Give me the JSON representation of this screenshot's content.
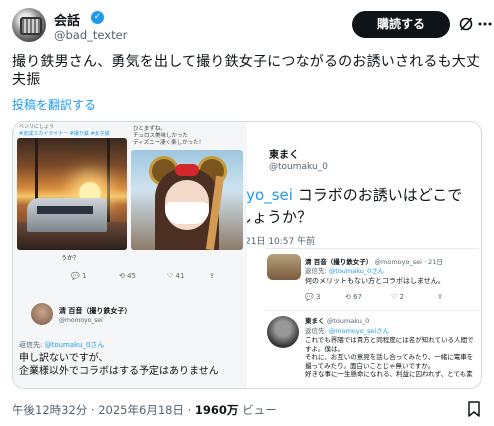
{
  "header": {
    "display_name": "会話",
    "handle": "@bad_texter",
    "subscribe_label": "購読する"
  },
  "tweet": {
    "text": "撮り鉄男さん、勇気を出して撮り鉄女子につながるのお誘いされるも大丈夫振",
    "translate_label": "投稿を翻訳する"
  },
  "left_shot": {
    "top_strip": "ベンリにしょう",
    "tags": "#京成スカイライナー #撮り鉄 #女子鉄",
    "note": "ひとまずね。\nチュロス美味しかった\nディズニー凄く楽しかった！",
    "uka": "うか？",
    "actions": {
      "reply": "1",
      "retweet": "45",
      "like": "41"
    },
    "reply_name": "清 百音（撮り鉄女子）",
    "reply_handle": "@momoyo_sei",
    "reply_to_prefix": "返信先: ",
    "reply_to_handle": "@toumaku_0さん",
    "reply_line1": "申し訳ないですが、",
    "reply_line2": "企業様以外でコラボはする予定はありません"
  },
  "right_shot": {
    "author": "東まく",
    "handle": "@toumaku_0",
    "text_mention": "oyo_sei",
    "text_rest": " コラボのお誘いはどこで",
    "text_line2": "しょうか？",
    "time": "21日 10:57 午前",
    "reply1": {
      "name": "清 百音（撮り鉄女子）",
      "meta": "@momoyo_sei · 21日",
      "reply_to_prefix": "返信先: ",
      "reply_to_handle": "@toumaku_0さん",
      "body": "何のメリットもない方とコラボはしません。",
      "actions": {
        "reply": "3",
        "retweet": "67",
        "like": "2"
      }
    },
    "reply2": {
      "name": "東まく",
      "handle": "@toumaku_0",
      "reply_to_prefix": "返信先: ",
      "reply_to_handle": "@momoyo_seiさん",
      "body": "これでも界隈では貴方と同程度には名が知れている人間ですよ。僕は。\nそれに、お互いの意見を話し合ってみたり、一緒に電車を撮ってみたり。面白いことじゃ無いですか。\n好きな事に一生懸命になれる、利益に囚われず、とても素"
    }
  },
  "footer": {
    "time": "午後12時32分 · 2025年6月18日 · ",
    "views_count": "1960万",
    "views_label": " ビュー"
  },
  "colors": {
    "accent": "#1d9bf0",
    "text": "#0f1419",
    "muted": "#536471"
  }
}
